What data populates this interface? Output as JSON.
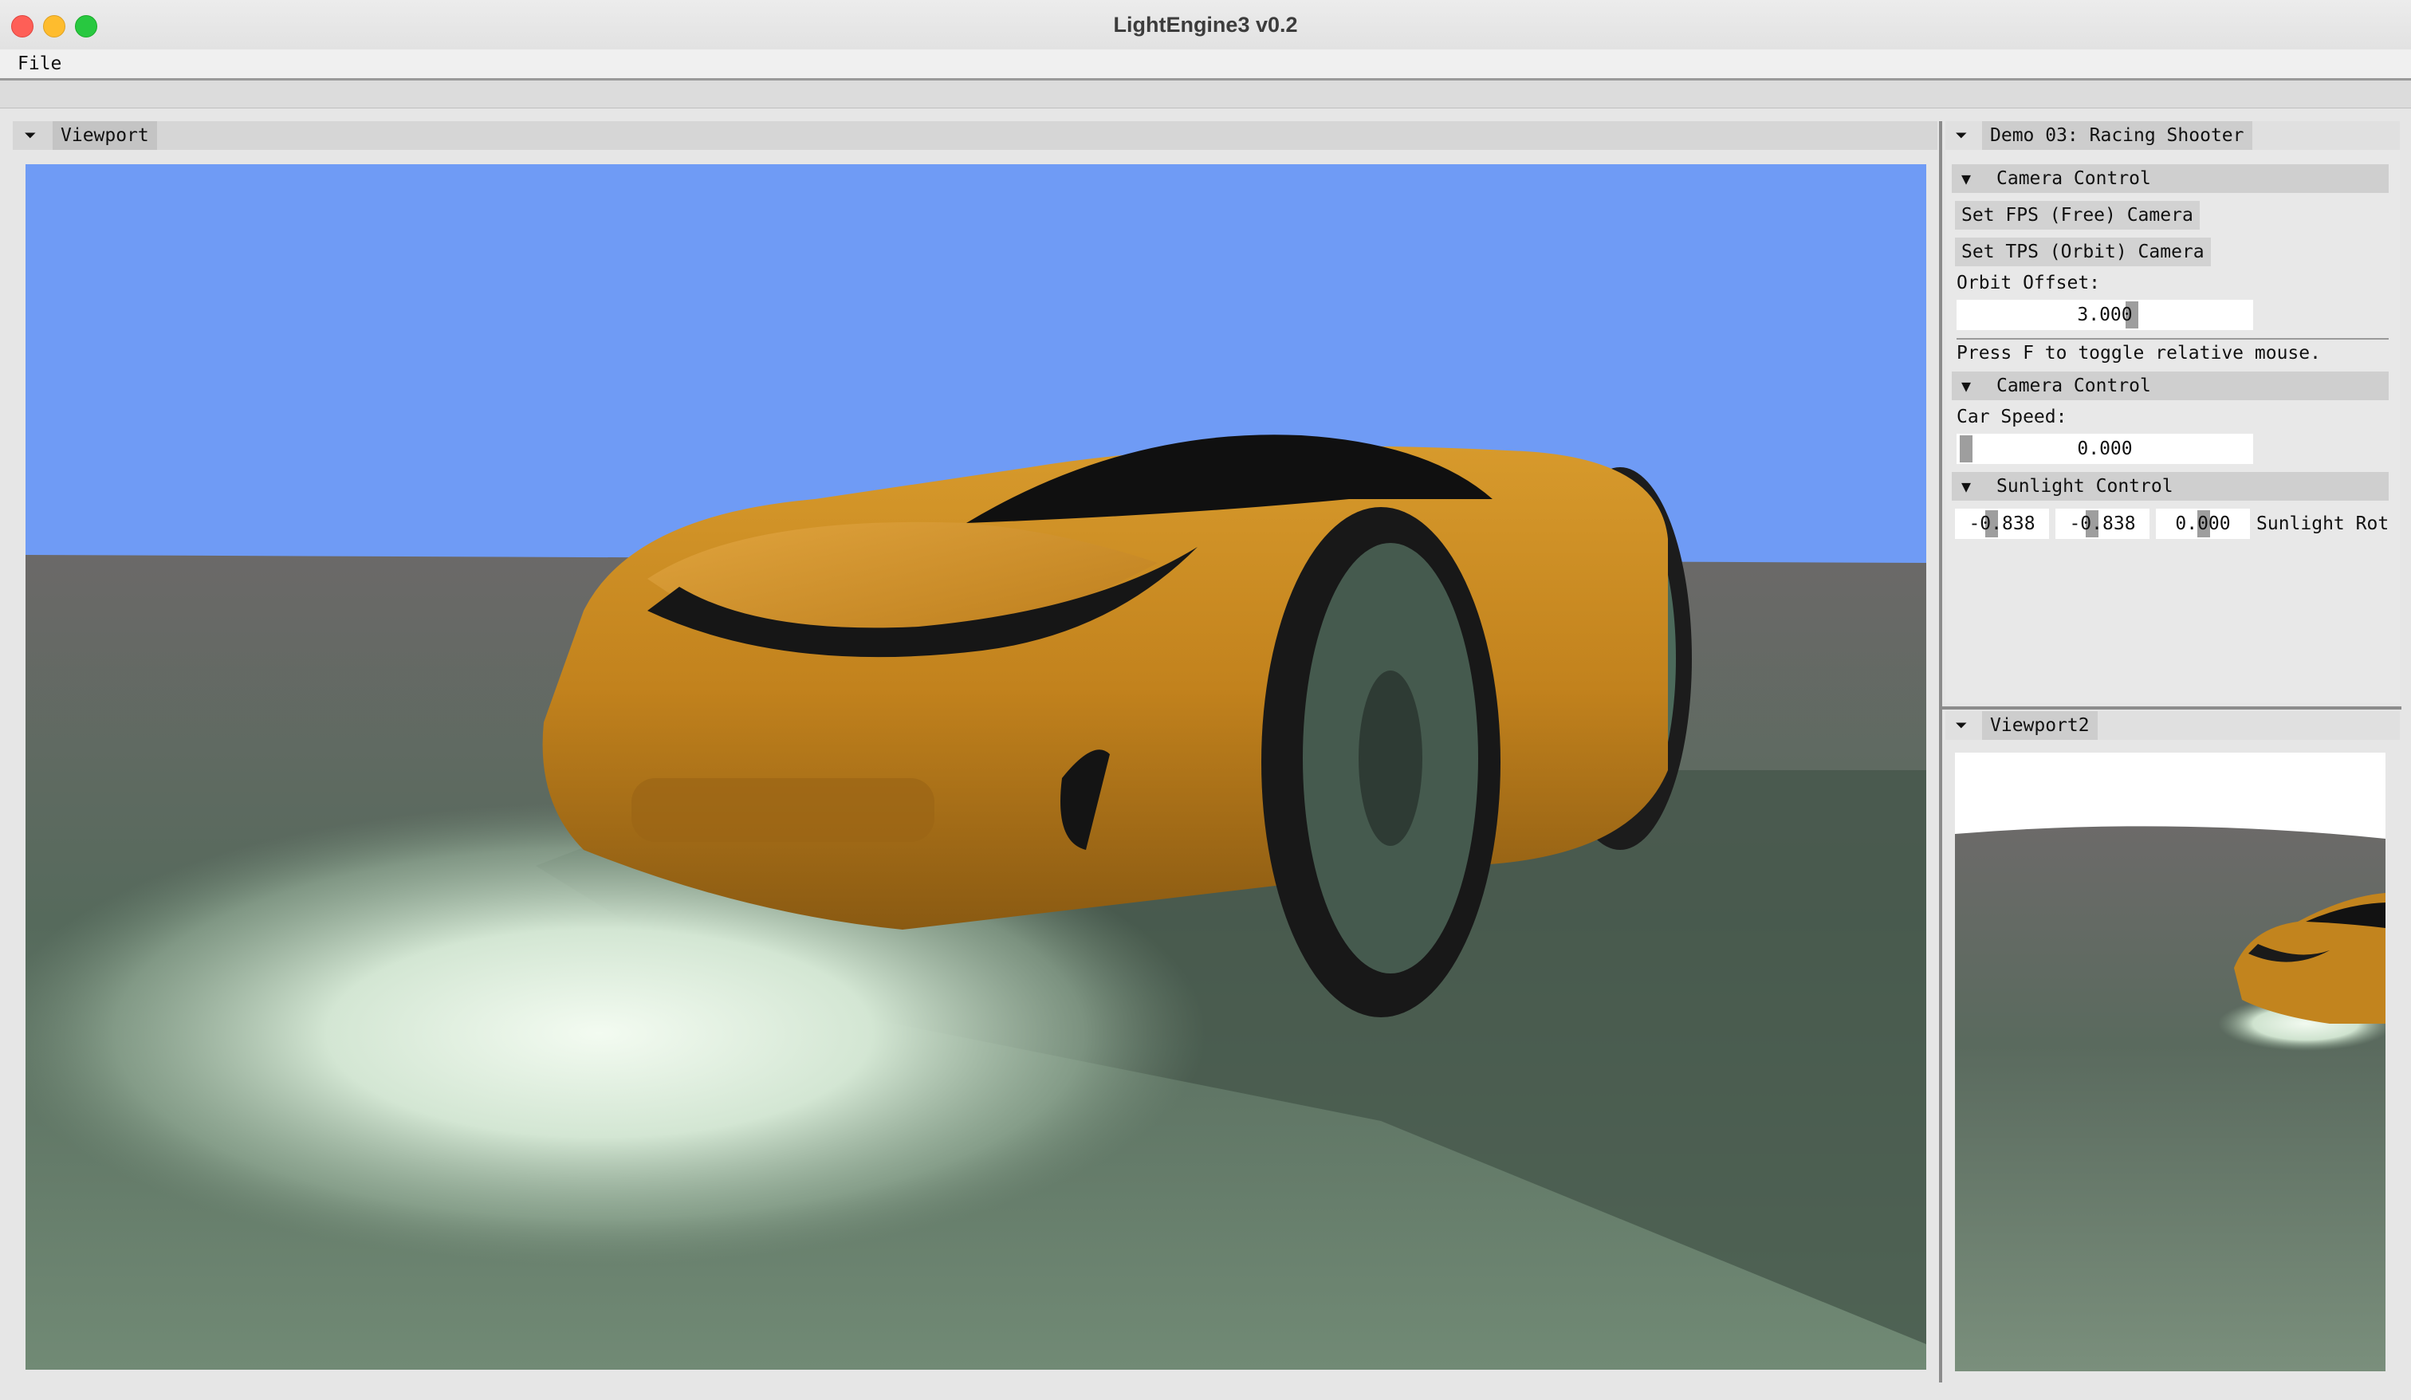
{
  "window": {
    "title": "LightEngine3 v0.2"
  },
  "menubar": {
    "items": [
      "File"
    ]
  },
  "viewport_panel": {
    "tab_label": "Viewport"
  },
  "demo_panel": {
    "tab_label": "Demo 03: Racing Shooter",
    "camera_section": {
      "header": "Camera Control",
      "fps_button": "Set FPS (Free) Camera",
      "tps_button": "Set TPS (Orbit) Camera",
      "orbit_offset_label": "Orbit Offset:",
      "orbit_offset_value": "3.000",
      "hint": "Press F to toggle relative mouse."
    },
    "car_section": {
      "header": "Camera Control",
      "car_speed_label": "Car Speed:",
      "car_speed_value": "0.000"
    },
    "sunlight_section": {
      "header": "Sunlight Control",
      "rot_x": "-0.838",
      "rot_y": "-0.838",
      "rot_z": "0.000",
      "rot_label": "Sunlight Rot"
    }
  },
  "viewport2_panel": {
    "tab_label": "Viewport2"
  },
  "icons": {
    "collapse": "triangle-down-icon",
    "section_arrow": "triangle-down-icon"
  },
  "colors": {
    "sky": "#6f9bf5",
    "car_body": "#c98a1e",
    "ground": "#6a7f6b"
  }
}
